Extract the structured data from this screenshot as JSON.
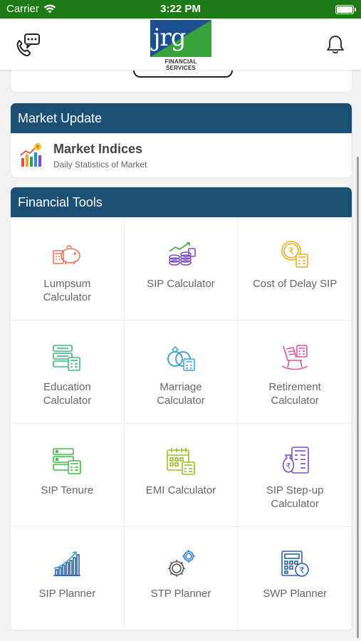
{
  "status_bar": {
    "carrier": "Carrier",
    "time": "3:22 PM"
  },
  "header": {
    "logo_text": "jrg",
    "logo_subtitle": "FINANCIAL SERVICES",
    "colors": {
      "logo_blue": "#1b4f8f",
      "logo_green": "#3aa23c"
    }
  },
  "market_update": {
    "title": "Market Update",
    "item": {
      "title": "Market Indices",
      "subtitle": "Daily Statistics of Market",
      "icon": "market-chart-icon"
    }
  },
  "financial_tools": {
    "title": "Financial Tools",
    "items": [
      {
        "label": "Lumpsum Calculator",
        "icon": "piggy-bank-icon",
        "color": "#e8735d"
      },
      {
        "label": "SIP Calculator",
        "icon": "coins-stack-icon",
        "color": "#7b4fc4"
      },
      {
        "label": "Cost of Delay SIP",
        "icon": "rupee-coin-calculator-icon",
        "color": "#e4b020"
      },
      {
        "label": "Education Calculator",
        "icon": "education-calculator-icon",
        "color": "#3fb878"
      },
      {
        "label": "Marriage Calculator",
        "icon": "rings-icon",
        "color": "#3a9fd8"
      },
      {
        "label": "Retirement Calculator",
        "icon": "rocking-chair-icon",
        "color": "#d957a0"
      },
      {
        "label": "SIP Tenure",
        "icon": "sip-tenure-icon",
        "color": "#47b849"
      },
      {
        "label": "EMI Calculator",
        "icon": "calendar-calculator-icon",
        "color": "#98bf2c"
      },
      {
        "label": "SIP Step-up Calculator",
        "icon": "rupee-bag-calculator-icon",
        "color": "#7b4fc4"
      },
      {
        "label": "SIP Planner",
        "icon": "growth-chart-icon",
        "color": "#2a5fa8"
      },
      {
        "label": "STP Planner",
        "icon": "gears-icon",
        "color": "#555555"
      },
      {
        "label": "SWP Planner",
        "icon": "calculator-rupee-icon",
        "color": "#2a5fa8"
      }
    ]
  },
  "theme": {
    "section_header": "#1b4f75",
    "status_bar": "#1c7a17"
  }
}
